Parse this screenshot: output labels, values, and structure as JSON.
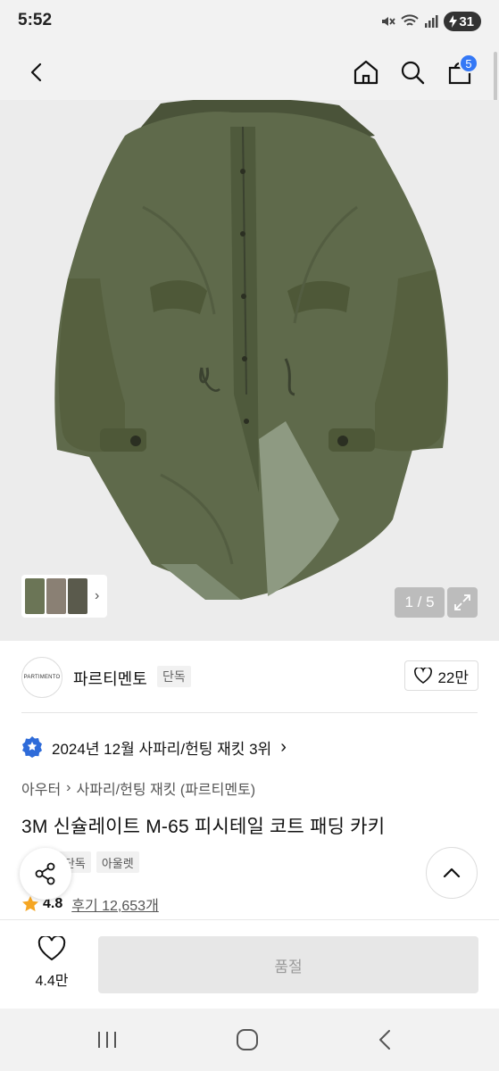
{
  "status_bar": {
    "time": "5:52",
    "battery": "31",
    "icons": [
      "mute-icon",
      "wifi-icon",
      "signal-icon",
      "battery-icon"
    ]
  },
  "top_nav": {
    "icons": [
      "back-icon",
      "home-icon",
      "search-icon",
      "cart-icon"
    ],
    "cart_count": "5"
  },
  "hero": {
    "page_counter": "1 / 5",
    "colors": {
      "coat": "#5f6a4b",
      "coat_dark": "#4a5339",
      "lining": "#8e9a82",
      "background": "#ececec"
    }
  },
  "brand": {
    "logo_text": "PARTIMENTO",
    "name": "파르티멘토",
    "tag": "단독",
    "likes": "22만"
  },
  "ranking": {
    "text": "2024년 12월 사파리/헌팅 재킷 3위"
  },
  "breadcrumb": {
    "category": "아우터",
    "subcategory": "사파리/헌팅 재킷 (파르티멘토)"
  },
  "product": {
    "title": "3M 신슐레이트 M-65 피시테일 코트 패딩 카키",
    "tags": [
      "단독",
      "아울렛"
    ],
    "rating": "4.8",
    "reviews": "후기 12,653개"
  },
  "action_bar": {
    "wish_count": "4.4만",
    "soldout_label": "품절"
  },
  "colors": {
    "accent": "#3478f6",
    "star": "#f5a623"
  }
}
